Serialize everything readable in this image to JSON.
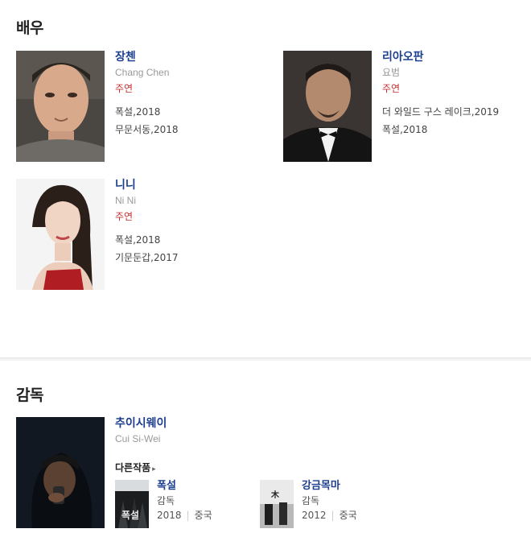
{
  "actors_section": {
    "title": "배우"
  },
  "actors": [
    {
      "name": "장첸",
      "eng": "Chang Chen",
      "role": "주연",
      "works": [
        "폭설,2018",
        "무문서동,2018"
      ]
    },
    {
      "name": "리아오판",
      "eng": "요범",
      "role": "주연",
      "works": [
        "더 와일드 구스 레이크,2019",
        "폭설,2018"
      ]
    },
    {
      "name": "니니",
      "eng": "Ni Ni",
      "role": "주연",
      "works": [
        "폭설,2018",
        "기문둔갑,2017"
      ]
    }
  ],
  "director_section": {
    "title": "감독"
  },
  "director": {
    "name": "추이시웨이",
    "eng": "Cui Si-Wei",
    "other_works_label": "다른작품",
    "movies": [
      {
        "title": "폭설",
        "role": "감독",
        "year": "2018",
        "country": "중국"
      },
      {
        "title": "강금목마",
        "role": "감독",
        "year": "2012",
        "country": "중국"
      }
    ]
  }
}
